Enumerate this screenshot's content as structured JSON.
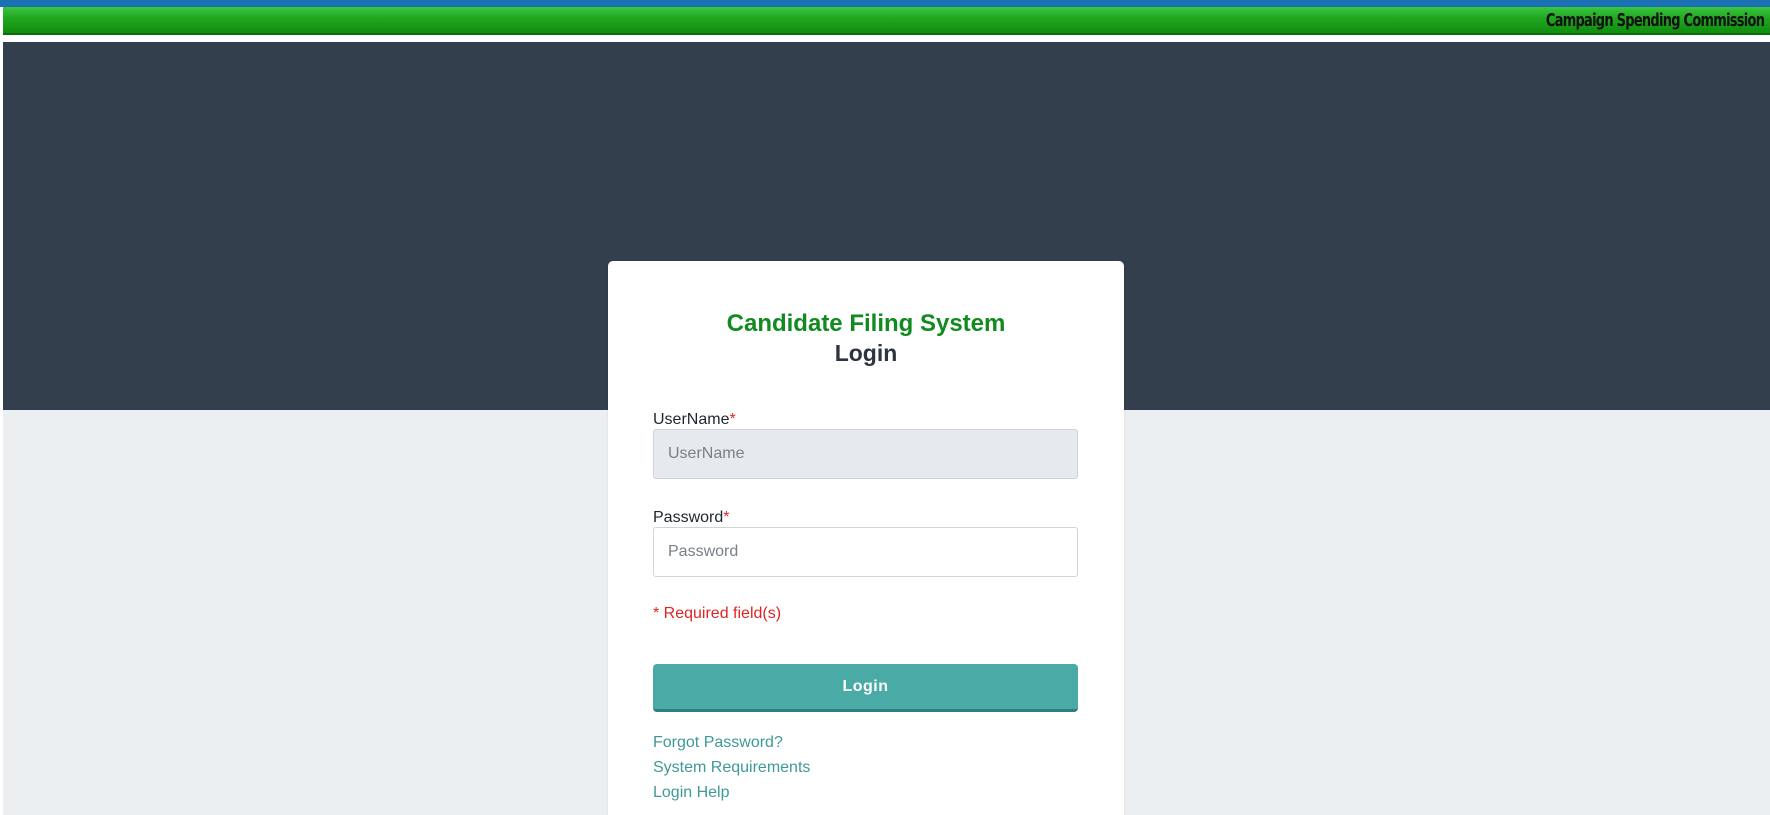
{
  "header": {
    "brand": "Campaign Spending Commission"
  },
  "login_card": {
    "title": "Candidate Filing System",
    "subtitle": "Login",
    "username": {
      "label": "UserName",
      "required_mark": "*",
      "placeholder": "UserName",
      "value": ""
    },
    "password": {
      "label": "Password",
      "required_mark": "*",
      "placeholder": "Password",
      "value": ""
    },
    "required_note": "* Required field(s)",
    "login_button_label": "Login",
    "links": {
      "forgot_password": "Forgot Password?",
      "system_requirements": "System Requirements",
      "login_help": "Login Help"
    }
  },
  "colors": {
    "header_green": "#21a51f",
    "hero_dark": "#343f4e",
    "title_green": "#118a1f",
    "button_teal": "#4aaba6",
    "link_teal": "#3e9a96",
    "required_red": "#e02424",
    "page_background": "#eceff2"
  }
}
